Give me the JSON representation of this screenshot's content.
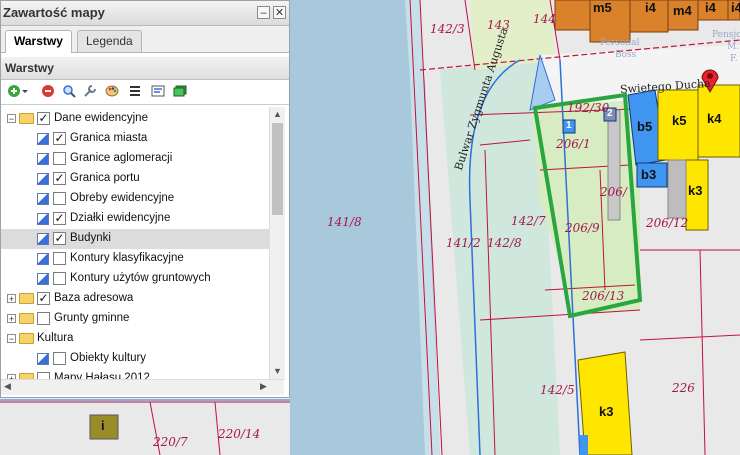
{
  "panel": {
    "title": "Zawartość mapy",
    "minimize_glyph": "–",
    "close_glyph": "✕",
    "tabs": [
      {
        "label": "Warstwy",
        "active": true
      },
      {
        "label": "Legenda",
        "active": false
      }
    ],
    "section_title": "Warstwy",
    "toolbar": [
      "add-layer-icon",
      "remove-layer-icon",
      "search-icon",
      "wrench-icon",
      "palette-icon",
      "list-icon",
      "properties-icon",
      "layers-icon"
    ],
    "tree": [
      {
        "label": "Dane ewidencyjne",
        "type": "group",
        "expanded": true,
        "checked": true
      },
      {
        "label": "Granica miasta",
        "type": "layer",
        "checked": true
      },
      {
        "label": "Granice aglomeracji",
        "type": "layer",
        "checked": false
      },
      {
        "label": "Granica portu",
        "type": "layer",
        "checked": true
      },
      {
        "label": "Obreby ewidencyjne",
        "type": "layer",
        "checked": false
      },
      {
        "label": "Działki ewidencyjne",
        "type": "layer",
        "checked": true
      },
      {
        "label": "Budynki",
        "type": "layer",
        "checked": true,
        "selected": true
      },
      {
        "label": "Kontury klasyfikacyjne",
        "type": "layer",
        "checked": false
      },
      {
        "label": "Kontury użytów gruntowych",
        "type": "layer",
        "checked": false
      },
      {
        "label": "Baza adresowa",
        "type": "group",
        "expanded": false,
        "checked": true
      },
      {
        "label": "Grunty gminne",
        "type": "group",
        "expanded": false,
        "checked": false
      },
      {
        "label": "Kultura",
        "type": "group",
        "expanded": true,
        "checked": null
      },
      {
        "label": "Obiekty kultury",
        "type": "layer",
        "checked": false
      },
      {
        "label": "Mapy Hałasu 2012",
        "type": "group",
        "expanded": false,
        "checked": false
      }
    ]
  },
  "map": {
    "parcel_labels": [
      "142/3",
      "143",
      "144",
      "141/8",
      "141/2",
      "142/8",
      "142/7",
      "192/30",
      "206/1",
      "206/",
      "206/9",
      "206/12",
      "206/13",
      "142/5",
      "226",
      "220/7",
      "220/14"
    ],
    "building_labels": [
      "m5",
      "i4",
      "m4",
      "i4",
      "i4",
      "b5",
      "k5",
      "k4",
      "b3",
      "k3",
      "k3",
      "i"
    ],
    "small_numbers": [
      "1",
      "2"
    ],
    "street_labels": [
      "Bulwar Zygmunta Augusta",
      "Swietego Ducha"
    ],
    "faded_texts": [
      "Personal",
      "Boss",
      "Pensjo",
      "M.",
      "F."
    ],
    "colors": {
      "water": "#a3c6db",
      "parcel_line": "#c0123e",
      "highlight": "#2aa640",
      "building_yellow": "#ffe600",
      "building_blue": "#3f95f0",
      "building_orange": "#d9822b"
    }
  }
}
